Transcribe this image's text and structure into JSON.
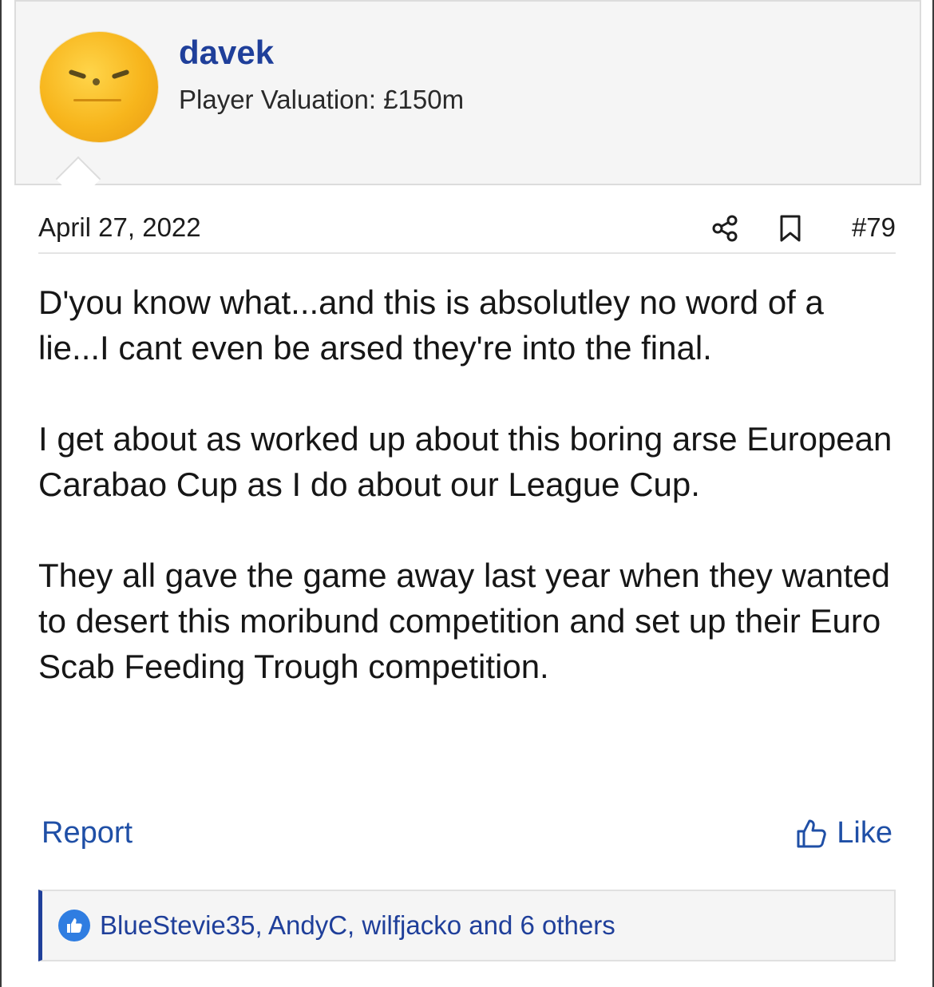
{
  "user": {
    "username": "davek",
    "valuation": "Player Valuation: £150m",
    "avatar_icon": "orange-face-avatar"
  },
  "post": {
    "date": "April 27, 2022",
    "number": "#79",
    "paragraphs": [
      "D'you know what...and this is absolutley no word of a lie...I cant even be arsed they're into the final.",
      "I get about as worked up about this boring arse European Carabao Cup as I do about our League Cup.",
      "They all gave the game away last year when they wanted to desert this moribund competition and set up their Euro Scab Feeding Trough competition."
    ]
  },
  "actions": {
    "report_label": "Report",
    "like_label": "Like"
  },
  "reactions": {
    "text": "BlueStevie35, AndyC, wilfjacko and 6 others"
  },
  "colors": {
    "accent": "#1f3f9a",
    "link": "#1f4fa6",
    "panel_bg": "#f5f5f5"
  }
}
